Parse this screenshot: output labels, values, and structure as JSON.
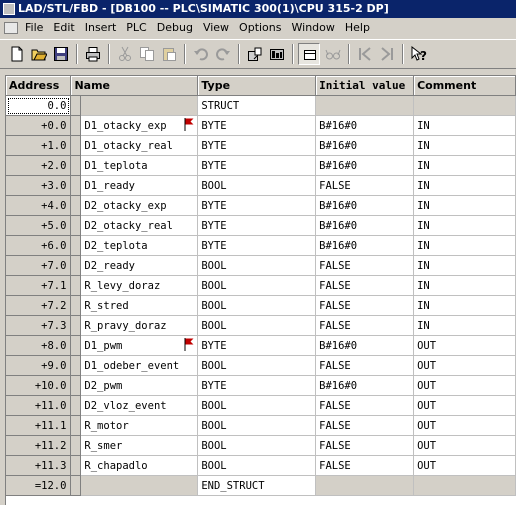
{
  "window": {
    "title": "LAD/STL/FBD - [DB100 -- PLC\\SIMATIC 300(1)\\CPU 315-2 DP]"
  },
  "menu": [
    "File",
    "Edit",
    "Insert",
    "PLC",
    "Debug",
    "View",
    "Options",
    "Window",
    "Help"
  ],
  "table": {
    "headers": {
      "address": "Address",
      "name": "Name",
      "type": "Type",
      "initial": "Initial value",
      "comment": "Comment"
    },
    "first_row": {
      "address": "0.0",
      "name": "",
      "type": "STRUCT",
      "initial": "",
      "comment": ""
    },
    "rows": [
      {
        "address": "+0.0",
        "name": "D1_otacky_exp",
        "type": "BYTE",
        "initial": "B#16#0",
        "comment": "IN",
        "flag": true
      },
      {
        "address": "+1.0",
        "name": "D1_otacky_real",
        "type": "BYTE",
        "initial": "B#16#0",
        "comment": "IN",
        "flag": false
      },
      {
        "address": "+2.0",
        "name": "D1_teplota",
        "type": "BYTE",
        "initial": "B#16#0",
        "comment": "IN",
        "flag": false
      },
      {
        "address": "+3.0",
        "name": "D1_ready",
        "type": "BOOL",
        "initial": "FALSE",
        "comment": "IN",
        "flag": false
      },
      {
        "address": "+4.0",
        "name": "D2_otacky_exp",
        "type": "BYTE",
        "initial": "B#16#0",
        "comment": "IN",
        "flag": false
      },
      {
        "address": "+5.0",
        "name": "D2_otacky_real",
        "type": "BYTE",
        "initial": "B#16#0",
        "comment": "IN",
        "flag": false
      },
      {
        "address": "+6.0",
        "name": "D2_teplota",
        "type": "BYTE",
        "initial": "B#16#0",
        "comment": "IN",
        "flag": false
      },
      {
        "address": "+7.0",
        "name": "D2_ready",
        "type": "BOOL",
        "initial": "FALSE",
        "comment": "IN",
        "flag": false
      },
      {
        "address": "+7.1",
        "name": "R_levy_doraz",
        "type": "BOOL",
        "initial": "FALSE",
        "comment": "IN",
        "flag": false
      },
      {
        "address": "+7.2",
        "name": "R_stred",
        "type": "BOOL",
        "initial": "FALSE",
        "comment": "IN",
        "flag": false
      },
      {
        "address": "+7.3",
        "name": "R_pravy_doraz",
        "type": "BOOL",
        "initial": "FALSE",
        "comment": "IN",
        "flag": false
      },
      {
        "address": "+8.0",
        "name": "D1_pwm",
        "type": "BYTE",
        "initial": "B#16#0",
        "comment": "OUT",
        "flag": true
      },
      {
        "address": "+9.0",
        "name": "D1_odeber_event",
        "type": "BOOL",
        "initial": "FALSE",
        "comment": "OUT",
        "flag": false
      },
      {
        "address": "+10.0",
        "name": "D2_pwm",
        "type": "BYTE",
        "initial": "B#16#0",
        "comment": "OUT",
        "flag": false
      },
      {
        "address": "+11.0",
        "name": "D2_vloz_event",
        "type": "BOOL",
        "initial": "FALSE",
        "comment": "OUT",
        "flag": false
      },
      {
        "address": "+11.1",
        "name": "R_motor",
        "type": "BOOL",
        "initial": "FALSE",
        "comment": "OUT",
        "flag": false
      },
      {
        "address": "+11.2",
        "name": "R_smer",
        "type": "BOOL",
        "initial": "FALSE",
        "comment": "OUT",
        "flag": false
      },
      {
        "address": "+11.3",
        "name": "R_chapadlo",
        "type": "BOOL",
        "initial": "FALSE",
        "comment": "OUT",
        "flag": false
      }
    ],
    "last_row": {
      "address": "=12.0",
      "name": "",
      "type": "END_STRUCT",
      "initial": "",
      "comment": ""
    }
  },
  "colors": {
    "titlebar": "#0a246a",
    "face": "#d4d0c8",
    "flag": "#c00000"
  }
}
